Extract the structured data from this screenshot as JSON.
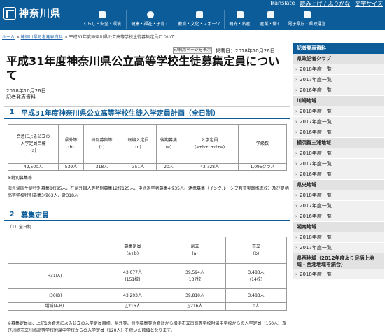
{
  "header": {
    "logo_text": "神奈川県",
    "util": [
      "Translate",
      "読み上げ / ふりがな",
      "文字サイズ"
    ],
    "nav": [
      {
        "label": "くらし・安全・環境",
        "icon": "house-icon"
      },
      {
        "label": "健康・福祉・子育て",
        "icon": "heart-icon"
      },
      {
        "label": "教育・文化・スポーツ",
        "icon": "book-icon"
      },
      {
        "label": "観光・名産",
        "icon": "camera-icon"
      },
      {
        "label": "産業・働く",
        "icon": "factory-icon"
      },
      {
        "label": "電子県庁・県政運営",
        "icon": "building-icon"
      }
    ],
    "accent": "#0b5c99"
  },
  "breadcrumb": {
    "home": "ホーム",
    "sep": " > ",
    "parent": "神奈川県記者発表資料",
    "current": "平成31年度神奈川県公立高等学校生徒募集定員について"
  },
  "page": {
    "print_button": "印刷用ページを表示",
    "posted": "掲載日：2018年10月26日",
    "title": "平成31年度神奈川県公立高等学校生徒募集定員について",
    "date": "2018年10月26日",
    "doc_type": "記者発表資料"
  },
  "section1": {
    "num": "1",
    "heading": "平成31年度神奈川県公立高等学校生徒入学定員計画（全日制）",
    "headers": [
      [
        "合意による公立の",
        "入学定員目標",
        "(a)"
      ],
      [
        "県外等",
        "(b)"
      ],
      [
        "特別募集等",
        "(c)"
      ],
      [
        "転編入定員",
        "(d)"
      ],
      [
        "後期募集",
        "(e)"
      ],
      [
        "入学定員",
        "(a+b+c+d+e)"
      ],
      [
        "学級数"
      ]
    ],
    "values": [
      "42,500人",
      "539人",
      "318人",
      "351人",
      "20人",
      "43,728人",
      "1,095クラス"
    ],
    "note1": "※特別募集等",
    "note2": "海外帰国生徒特別募集8校95人、在県外国人等特別募集12校125人、中途退学者募集4校35人、連携募集（インクルーシブ教育実践推進校）及び足柄高等学校特別募集3校63人、計318人"
  },
  "section2": {
    "num": "2",
    "heading": "募集定員",
    "sub": "（1）全日制",
    "headers": {
      "total": [
        "募集定員",
        "(a+b)"
      ],
      "pref": [
        "県立",
        "(a)"
      ],
      "city": [
        "市立",
        "(b)"
      ]
    },
    "rows": [
      {
        "label": "H31(A)",
        "total": [
          "43,077人",
          "(151校)"
        ],
        "pref": [
          "39,594人",
          "(137校)"
        ],
        "city": [
          "3,483人",
          "(14校)"
        ]
      },
      {
        "label": "H30(B)",
        "total": [
          "43,293人"
        ],
        "pref": [
          "39,810人"
        ],
        "city": [
          "3,483人"
        ]
      },
      {
        "label": "増減(A-B)",
        "total": [
          "△216人"
        ],
        "pref": [
          "△216人"
        ],
        "city": [
          "0人"
        ]
      }
    ],
    "footnote": "※募集定員は、上記1の合意による公立の入学定員目標、県外等、特別募集等の合計から横浜市立南高等学校附属中学校からの入学定員（160人）及び川崎市立川崎高等学校附属中学校からの入学定員（120人）を除いた数値となります。"
  },
  "sidebar": {
    "header": "記者発表資料",
    "groups": [
      {
        "name": "県政記者クラブ",
        "links": [
          "2018年度一覧",
          "2017年度一覧",
          "2016年度一覧"
        ]
      },
      {
        "name": "川崎地域",
        "links": [
          "2018年度一覧",
          "2017年度一覧",
          "2016年度一覧"
        ]
      },
      {
        "name": "横須賀三浦地域",
        "links": [
          "2018年度一覧",
          "2017年度一覧",
          "2016年度一覧"
        ]
      },
      {
        "name": "県央地域",
        "links": [
          "2018年度一覧",
          "2017年度一覧",
          "2016年度一覧"
        ]
      },
      {
        "name": "湘南地域",
        "links": [
          "2018年度一覧",
          "2017年度一覧"
        ]
      },
      {
        "name": "県西地域（2012年度より足柄上地域・西湘地域を統合）",
        "links": [
          "2018年度一覧"
        ]
      }
    ]
  }
}
